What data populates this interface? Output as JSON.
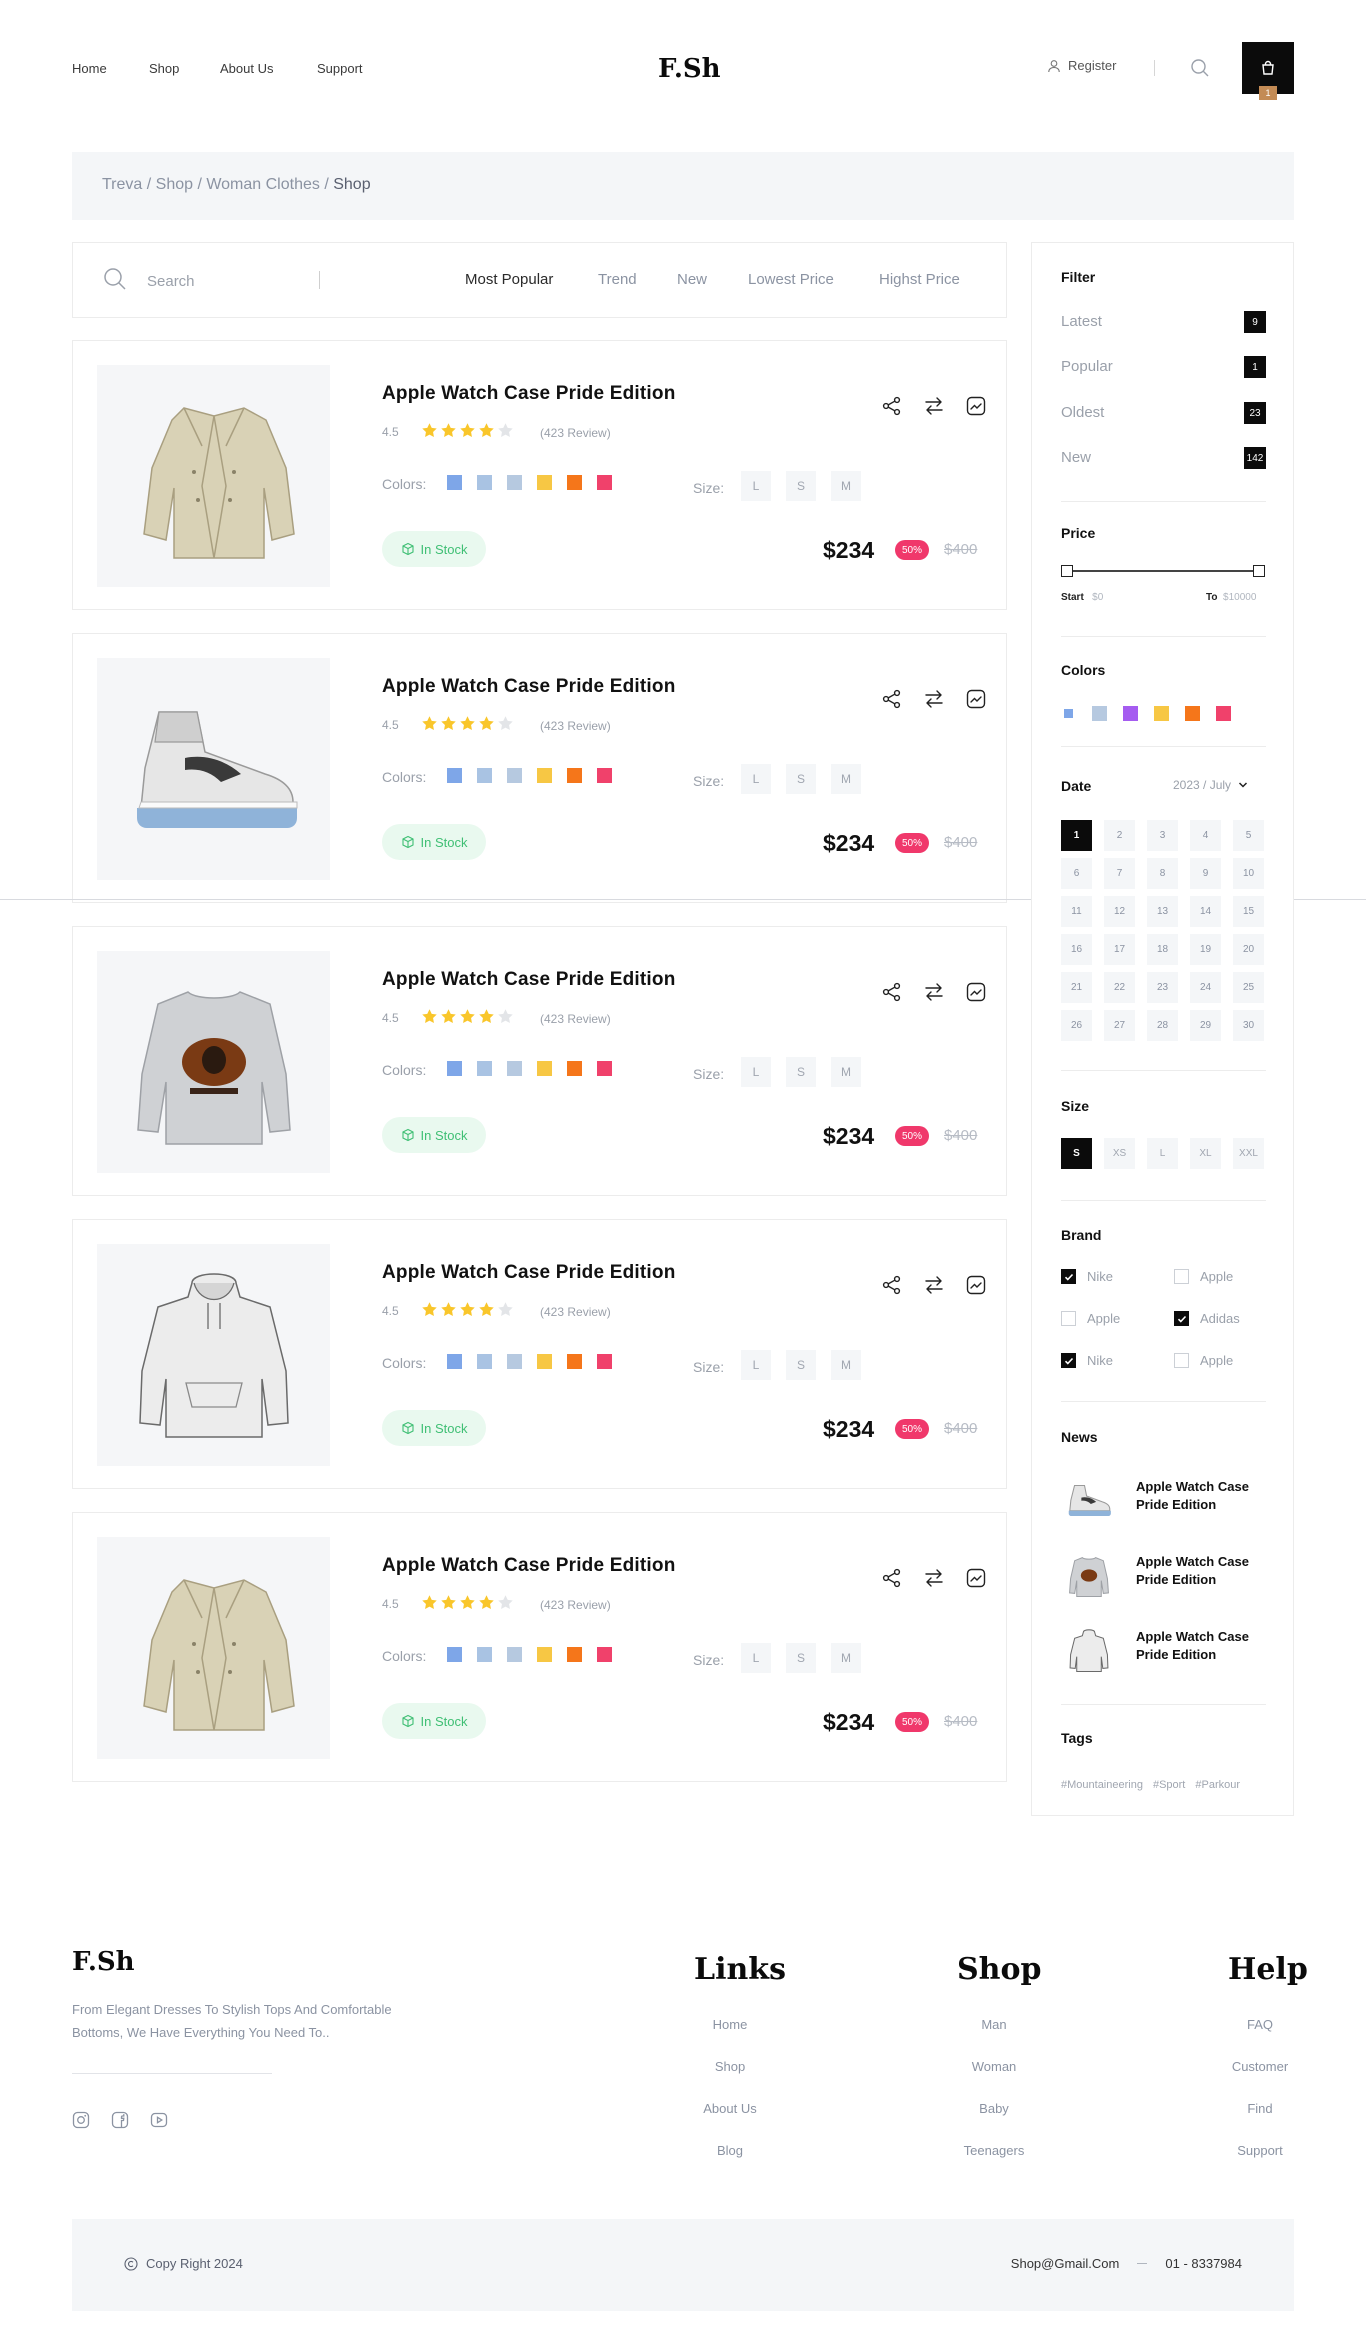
{
  "header": {
    "nav": [
      "Home",
      "Shop",
      "About Us",
      "Support"
    ],
    "logo": "F.Sh",
    "register_label": "Register",
    "cart_count": "1"
  },
  "breadcrumb": {
    "path": "Treva / Shop / Woman Clothes / ",
    "current": "Shop"
  },
  "search": {
    "placeholder": "Search",
    "sort_tabs": [
      "Most Popular",
      "Trend",
      "New",
      "Lowest Price",
      "Highst Price"
    ],
    "active_tab": "Most Popular"
  },
  "products": [
    {
      "title": "Apple Watch Case Pride Edition",
      "rating": "4.5",
      "stars": 4,
      "reviews": "(423 Review)",
      "image": "jacket-image",
      "stock": "In Stock",
      "price": "$234",
      "discount": "50%",
      "old_price": "$400"
    },
    {
      "title": "Apple Watch Case Pride Edition",
      "rating": "4.5",
      "stars": 4,
      "reviews": "(423 Review)",
      "image": "sneaker-image",
      "stock": "In Stock",
      "price": "$234",
      "discount": "50%",
      "old_price": "$400"
    },
    {
      "title": "Apple Watch Case Pride Edition",
      "rating": "4.5",
      "stars": 4,
      "reviews": "(423 Review)",
      "image": "sweatshirt-image",
      "stock": "In Stock",
      "price": "$234",
      "discount": "50%",
      "old_price": "$400"
    },
    {
      "title": "Apple Watch Case Pride Edition",
      "rating": "4.5",
      "stars": 4,
      "reviews": "(423 Review)",
      "image": "hoodie-image",
      "stock": "In Stock",
      "price": "$234",
      "discount": "50%",
      "old_price": "$400"
    },
    {
      "title": "Apple Watch Case Pride Edition",
      "rating": "4.5",
      "stars": 4,
      "reviews": "(423 Review)",
      "image": "jacket-image",
      "stock": "In Stock",
      "price": "$234",
      "discount": "50%",
      "old_price": "$400"
    }
  ],
  "product_labels": {
    "colors": "Colors:",
    "size": "Size:",
    "sizes": [
      "L",
      "S",
      "M"
    ],
    "swatches": [
      "#7ea6e8",
      "#a9c3e3",
      "#b6c9e0",
      "#f7c744",
      "#f5761a",
      "#f0416b"
    ]
  },
  "sidebar": {
    "filter": {
      "title": "Filter",
      "items": [
        {
          "label": "Latest",
          "count": "9"
        },
        {
          "label": "Popular",
          "count": "1"
        },
        {
          "label": "Oldest",
          "count": "23"
        },
        {
          "label": "New",
          "count": "142"
        }
      ]
    },
    "price": {
      "title": "Price",
      "start_label": "Start",
      "start_value": "$0",
      "to_label": "To",
      "to_value": "$10000"
    },
    "colors": {
      "title": "Colors",
      "values": [
        "#7ea6e8",
        "#b6c9e0",
        "#a55cf0",
        "#f7c744",
        "#f5761a",
        "#f0416b"
      ],
      "selected": 0
    },
    "date": {
      "title": "Date",
      "selected_month": "2023 / July",
      "days": [
        "1",
        "2",
        "3",
        "4",
        "5",
        "6",
        "7",
        "8",
        "9",
        "10",
        "11",
        "12",
        "13",
        "14",
        "15",
        "16",
        "17",
        "18",
        "19",
        "20",
        "21",
        "22",
        "23",
        "24",
        "25",
        "26",
        "27",
        "28",
        "29",
        "30"
      ],
      "selected_day": "1"
    },
    "size": {
      "title": "Size",
      "values": [
        "S",
        "XS",
        "L",
        "XL",
        "XXL"
      ],
      "selected": "S"
    },
    "brand": {
      "title": "Brand",
      "items": [
        {
          "label": "Nike",
          "checked": true
        },
        {
          "label": "Apple",
          "checked": false
        },
        {
          "label": "Apple",
          "checked": false
        },
        {
          "label": "Adidas",
          "checked": true
        },
        {
          "label": "Nike",
          "checked": true
        },
        {
          "label": "Apple",
          "checked": false
        }
      ]
    },
    "news": {
      "title": "News",
      "items": [
        {
          "title": "Apple Watch Case Pride Edition",
          "image": "sneaker-thumb"
        },
        {
          "title": "Apple Watch Case Pride Edition",
          "image": "sweatshirt-thumb"
        },
        {
          "title": "Apple Watch Case Pride Edition",
          "image": "hoodie-thumb"
        }
      ]
    },
    "tags": {
      "title": "Tags",
      "items": [
        "#Mountaineering",
        "#Sport",
        "#Parkour"
      ]
    }
  },
  "footer": {
    "logo": "F.Sh",
    "description": "From Elegant Dresses To Stylish Tops And Comfortable Bottoms, We Have Everything You Need To..",
    "social": [
      "instagram-icon",
      "facebook-icon",
      "youtube-icon"
    ],
    "columns": [
      {
        "title": "Links",
        "items": [
          "Home",
          "Shop",
          "About Us",
          "Blog"
        ]
      },
      {
        "title": "Shop",
        "items": [
          "Man",
          "Woman",
          "Baby",
          "Teenagers"
        ]
      },
      {
        "title": "Help",
        "items": [
          "FAQ",
          "Customer",
          "Find",
          "Support"
        ]
      }
    ],
    "copyright": "Copy Right 2024",
    "email": "Shop@Gmail.Com",
    "phone": "01 - 8337984"
  }
}
